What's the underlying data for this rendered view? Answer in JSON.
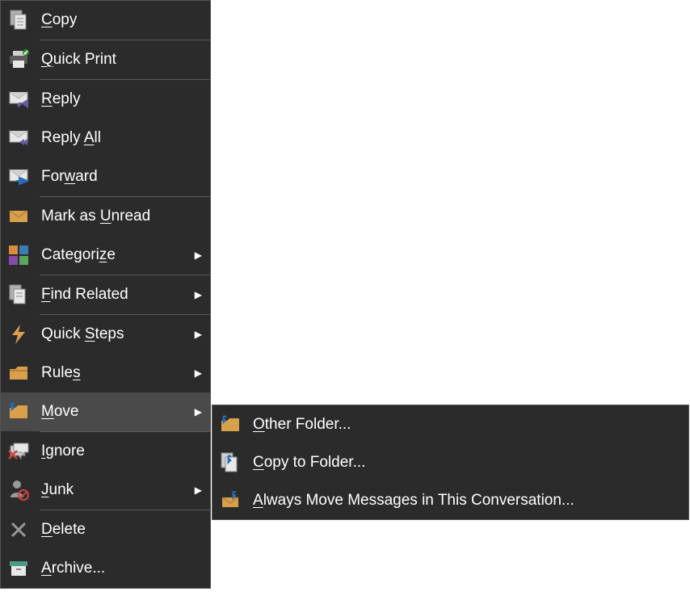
{
  "menu": {
    "copy": {
      "pre": "",
      "u": "C",
      "post": "opy"
    },
    "quickprint": {
      "pre": "",
      "u": "Q",
      "post": "uick Print"
    },
    "reply": {
      "pre": "",
      "u": "R",
      "post": "eply"
    },
    "replyall": {
      "pre": "Reply ",
      "u": "A",
      "post": "ll"
    },
    "forward": {
      "pre": "For",
      "u": "w",
      "post": "ard"
    },
    "markunread": {
      "pre": "Mark as ",
      "u": "U",
      "post": "nread"
    },
    "categorize": {
      "pre": "Categori",
      "u": "z",
      "post": "e"
    },
    "findrelated": {
      "pre": "",
      "u": "F",
      "post": "ind Related"
    },
    "quicksteps": {
      "pre": "Quick ",
      "u": "S",
      "post": "teps"
    },
    "rules": {
      "pre": "Rule",
      "u": "s",
      "post": ""
    },
    "move": {
      "pre": "",
      "u": "M",
      "post": "ove"
    },
    "ignore": {
      "pre": "",
      "u": "I",
      "post": "gnore"
    },
    "junk": {
      "pre": "",
      "u": "J",
      "post": "unk"
    },
    "delete": {
      "pre": "",
      "u": "D",
      "post": "elete"
    },
    "archive": {
      "pre": "",
      "u": "A",
      "post": "rchive..."
    }
  },
  "submenu": {
    "otherfolder": {
      "pre": "",
      "u": "O",
      "post": "ther Folder..."
    },
    "copytofolder": {
      "pre": "",
      "u": "C",
      "post": "opy to Folder..."
    },
    "alwaysmove": {
      "pre": "",
      "u": "A",
      "post": "lways Move Messages in This Conversation..."
    }
  }
}
